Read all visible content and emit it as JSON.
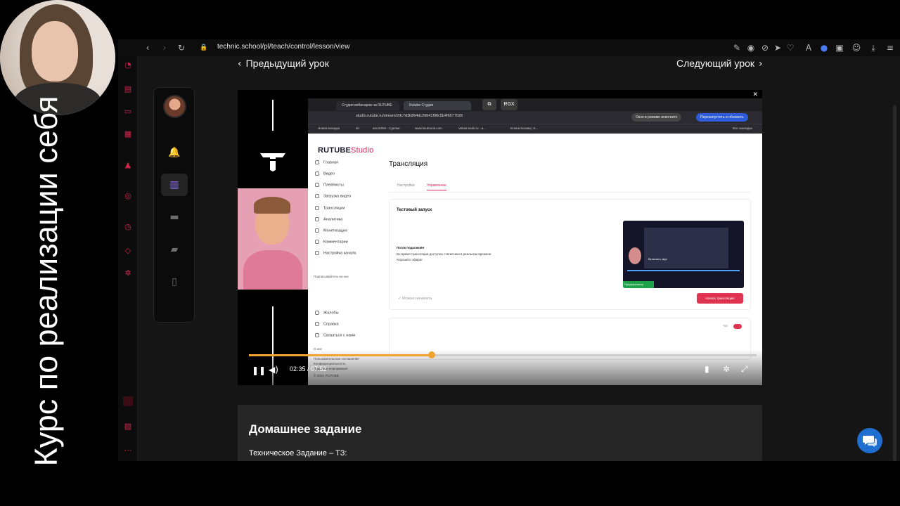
{
  "browser": {
    "url": "technic.school/pl/teach/control/lesson/view"
  },
  "lesson_nav": {
    "prev_label": "Предыдущий урок",
    "next_label": "Следующий урок"
  },
  "player": {
    "time_display": "02:35 / 07:52",
    "progress": 0.36,
    "float_badge": "RGX",
    "screen": {
      "tabs": [
        "Студия вебинаров на RUTUBE",
        "Rutube Студия"
      ],
      "url": "studio.rutube.ru/stream/23c7d3b864dc26641f98c5b4f6577028",
      "incognito_chip": "Окно в режиме инкогнито",
      "reload_chip": "Перезапустить и обновить",
      "bookmarks": [
        "Новая вкладка",
        "tel",
        "amoCRM - Сделки",
        "www.facebook.com",
        "Vekas-tools.ru - а...",
        "Елена Козова | E...",
        "Все закладки"
      ],
      "logo_main": "RUTUBE",
      "logo_accent": "Studio",
      "nav_items": [
        "Главная",
        "Видео",
        "Плейлисты",
        "Загрузка видео",
        "Трансляции",
        "Аналитика",
        "Монетизация",
        "Комментарии",
        "Настройка канала"
      ],
      "subscribe_label": "Подписывайтесь на нас",
      "footer_items": [
        "Жалобы",
        "Справка",
        "Связаться с нами"
      ],
      "footer_links": [
        "О нас",
        "Пользовательское соглашение",
        "Конфиденциальность",
        "Правовая информация",
        "© 2024, RUTUBE"
      ],
      "page_title": "Трансляция",
      "tabs_inner": [
        "Настройки",
        "Управление"
      ],
      "card_title": "Тестовый запуск",
      "stream_connected": "Поток подключён",
      "stream_desc": "Во время трансляции доступна статистика в реальном времени",
      "stream_wish": "Хорошего эфира!",
      "ready_label": "Можно начинать",
      "preview_button": "Включить звук",
      "live_badge": "Предпросмотр",
      "start_button": "Начать трансляцию",
      "chat_label": "Чат"
    }
  },
  "homework": {
    "title": "Домашнее задание",
    "subtitle": "Техническое Задание – ТЗ:"
  },
  "overlay": {
    "vertical_title": "Курс по реализации себя"
  },
  "colors": {
    "accent_orange": "#f0a431",
    "rutube_pink": "#e0245e",
    "rail_red": "#d0254a",
    "menu_active": "#8a6cf0",
    "chat_blue": "#1f6fd1"
  }
}
